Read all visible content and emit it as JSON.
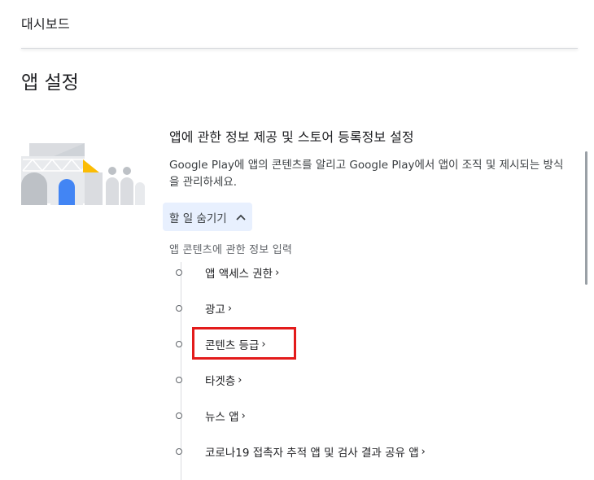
{
  "header": {
    "breadcrumb": "대시보드"
  },
  "section": {
    "title": "앱 설정"
  },
  "card": {
    "title": "앱에 관한 정보 제공 및 스토어 등록정보 설정",
    "description": "Google Play에 앱의 콘텐츠를 알리고 Google Play에서 앱이 조직 및 제시되는 방식을 관리하세요.",
    "toggle_label": "할 일 숨기기",
    "toggle_icon": "chevron-up-icon",
    "illustration_icon": "store-illustration-icon"
  },
  "tasks": {
    "section_label": "앱 콘텐츠에 관한 정보 입력",
    "items": [
      {
        "label": "앱 액세스 권한",
        "chevron": "›"
      },
      {
        "label": "광고",
        "chevron": "›"
      },
      {
        "label": "콘텐츠 등급",
        "chevron": "›"
      },
      {
        "label": "타겟층",
        "chevron": "›"
      },
      {
        "label": "뉴스 앱",
        "chevron": "›"
      },
      {
        "label": "코로나19 접촉자 추적 앱 및 검사 결과 공유 앱",
        "chevron": "›"
      }
    ]
  },
  "colors": {
    "highlight": "#e31b1b",
    "toggle_bg": "#e8f0fe",
    "accent_blue": "#4285f4",
    "accent_yellow": "#fbbc04"
  }
}
